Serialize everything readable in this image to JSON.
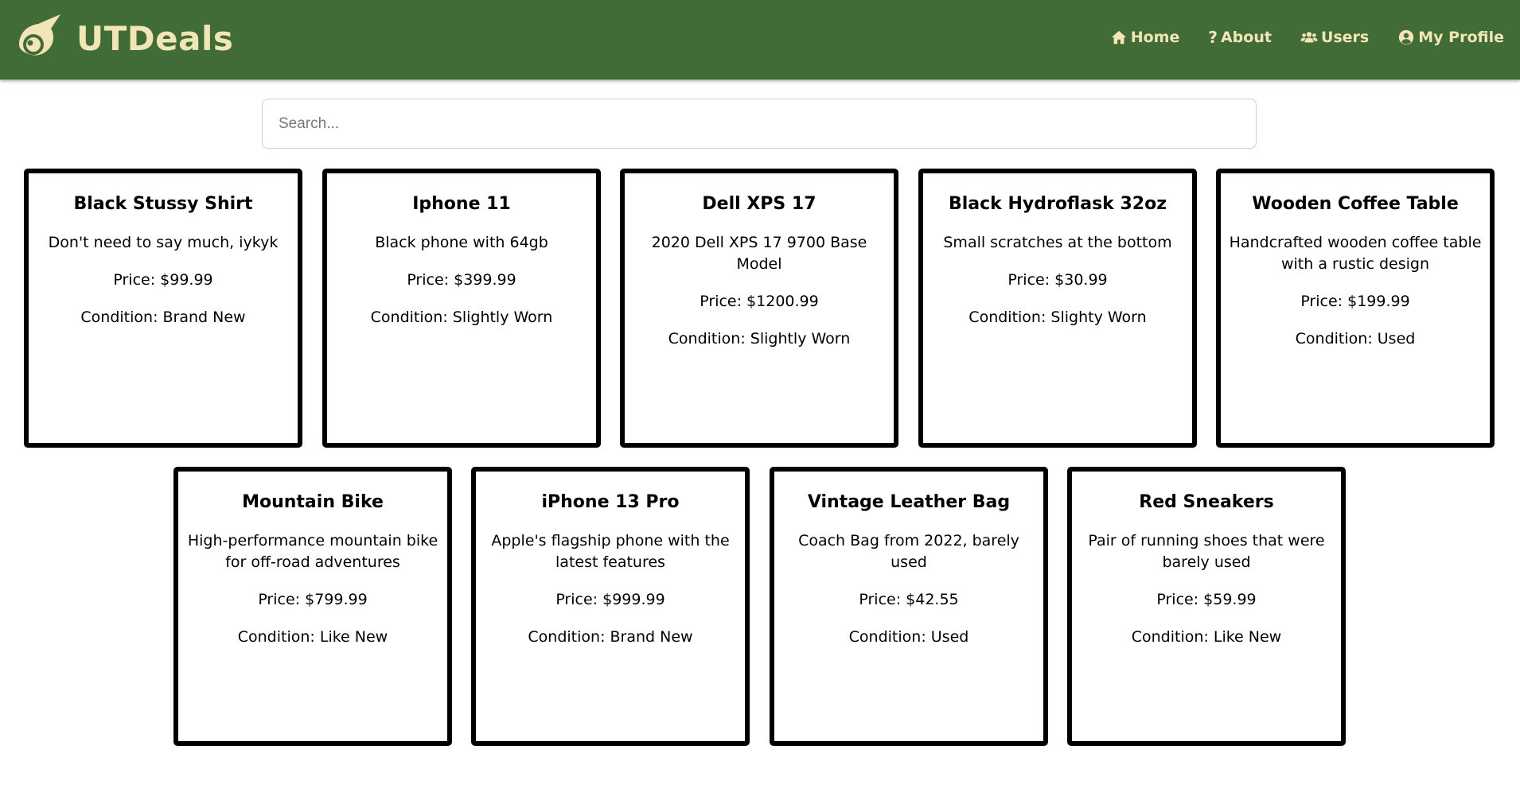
{
  "brand": {
    "name": "UTDeals",
    "colors": {
      "navbar": "#416b37",
      "accent": "#f3e6b6"
    }
  },
  "nav": {
    "home": "Home",
    "about": "About",
    "users": "Users",
    "profile": "My Profile"
  },
  "search": {
    "placeholder": "Search...",
    "value": ""
  },
  "listings": [
    {
      "title": "Black Stussy Shirt",
      "description": "Don't need to say much, iykyk",
      "price": "Price: $99.99",
      "condition": "Condition: Brand New"
    },
    {
      "title": "Iphone 11",
      "description": "Black phone with 64gb",
      "price": "Price: $399.99",
      "condition": "Condition: Slightly Worn"
    },
    {
      "title": "Dell XPS 17",
      "description": "2020 Dell XPS 17 9700 Base Model",
      "price": "Price: $1200.99",
      "condition": "Condition: Slightly Worn"
    },
    {
      "title": "Black Hydroflask 32oz",
      "description": "Small scratches at the bottom",
      "price": "Price: $30.99",
      "condition": "Condition: Slighty Worn"
    },
    {
      "title": "Wooden Coffee Table",
      "description": "Handcrafted wooden coffee table with a rustic design",
      "price": "Price: $199.99",
      "condition": "Condition: Used"
    },
    {
      "title": "Mountain Bike",
      "description": "High-performance mountain bike for off-road adventures",
      "price": "Price: $799.99",
      "condition": "Condition: Like New"
    },
    {
      "title": "iPhone 13 Pro",
      "description": "Apple's flagship phone with the latest features",
      "price": "Price: $999.99",
      "condition": "Condition: Brand New"
    },
    {
      "title": "Vintage Leather Bag",
      "description": "Coach Bag from 2022, barely used",
      "price": "Price: $42.55",
      "condition": "Condition: Used"
    },
    {
      "title": "Red Sneakers",
      "description": "Pair of running shoes that were barely used",
      "price": "Price: $59.99",
      "condition": "Condition: Like New"
    }
  ]
}
